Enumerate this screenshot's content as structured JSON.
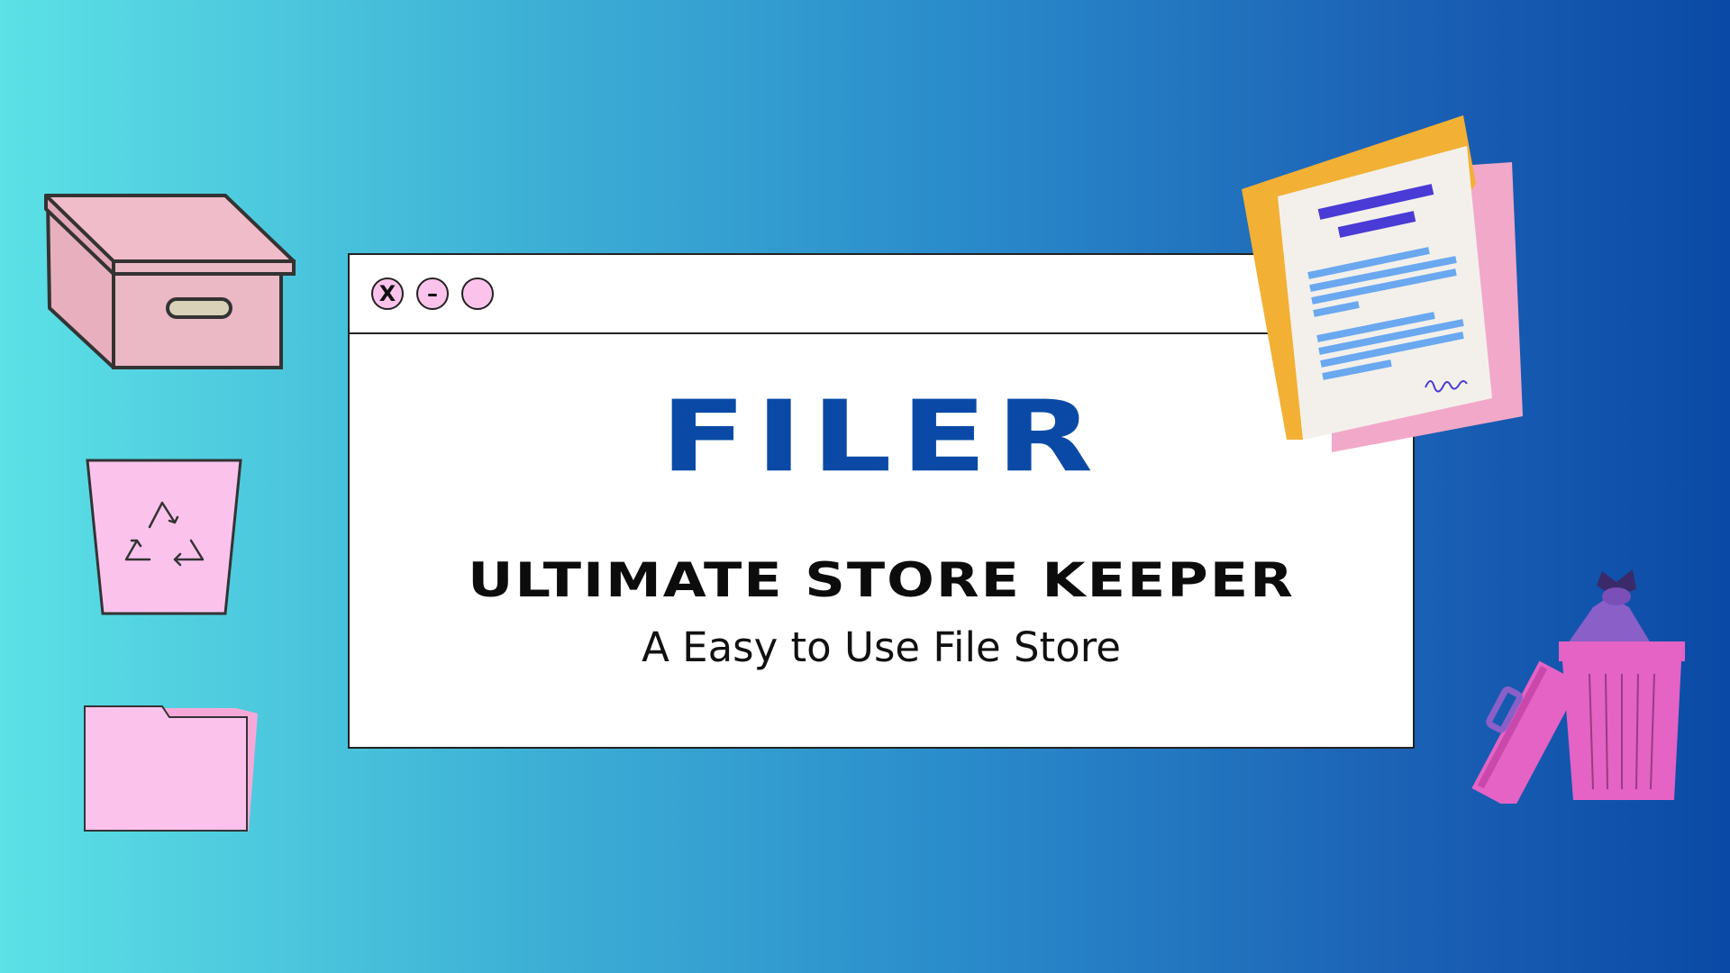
{
  "window": {
    "controls": [
      {
        "name": "close",
        "label": "X"
      },
      {
        "name": "minimize",
        "label": "–"
      },
      {
        "name": "maximize",
        "label": ""
      }
    ],
    "title": "FILER",
    "subtitle": "ULTIMATE STORE KEEPER",
    "tagline": "A Easy to Use File Store"
  },
  "decorations": {
    "box_icon": "storage-box-icon",
    "recycle_bin_icon": "recycle-bin-icon",
    "folder_icon": "folder-icon",
    "document_icon": "document-icon",
    "trash_can_icon": "trash-can-icon"
  },
  "colors": {
    "title_blue": "#0a4aa6",
    "button_pink": "#fbc3ec",
    "gradient_start": "#5ce1e6",
    "gradient_end": "#0a4aa6"
  }
}
